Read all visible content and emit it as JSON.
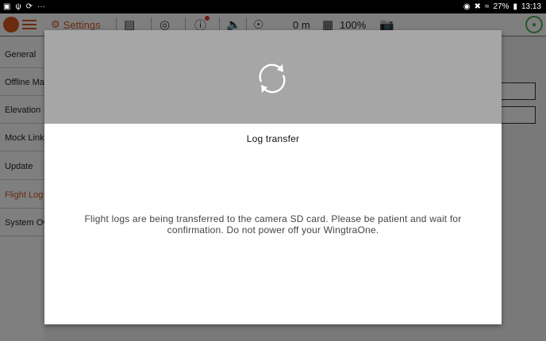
{
  "statusbar": {
    "left_icons": [
      "image-icon",
      "usb-icon",
      "sync-icon",
      "more-icon"
    ],
    "more": "···",
    "battery_percent": "27%",
    "time": "13:13"
  },
  "appbar": {
    "settings_label": "Settings",
    "distance": "0 m",
    "battery": "100%"
  },
  "sidebar": {
    "items": [
      {
        "label": "General",
        "active": false
      },
      {
        "label": "Offline Ma",
        "active": false
      },
      {
        "label": "Elevation",
        "active": false
      },
      {
        "label": "Mock Link",
        "active": false
      },
      {
        "label": "Update",
        "active": false
      },
      {
        "label": "Flight Log",
        "active": true
      },
      {
        "label": "System Ov",
        "active": false
      }
    ]
  },
  "dialog": {
    "title": "Log transfer",
    "message": "Flight logs are being transferred to the camera SD card. Please be patient and wait for confirmation. Do not power off your WingtraOne."
  },
  "colors": {
    "accent": "#d4571f",
    "dialog_header": "#a6a6a6",
    "status_green": "#4caf50"
  }
}
